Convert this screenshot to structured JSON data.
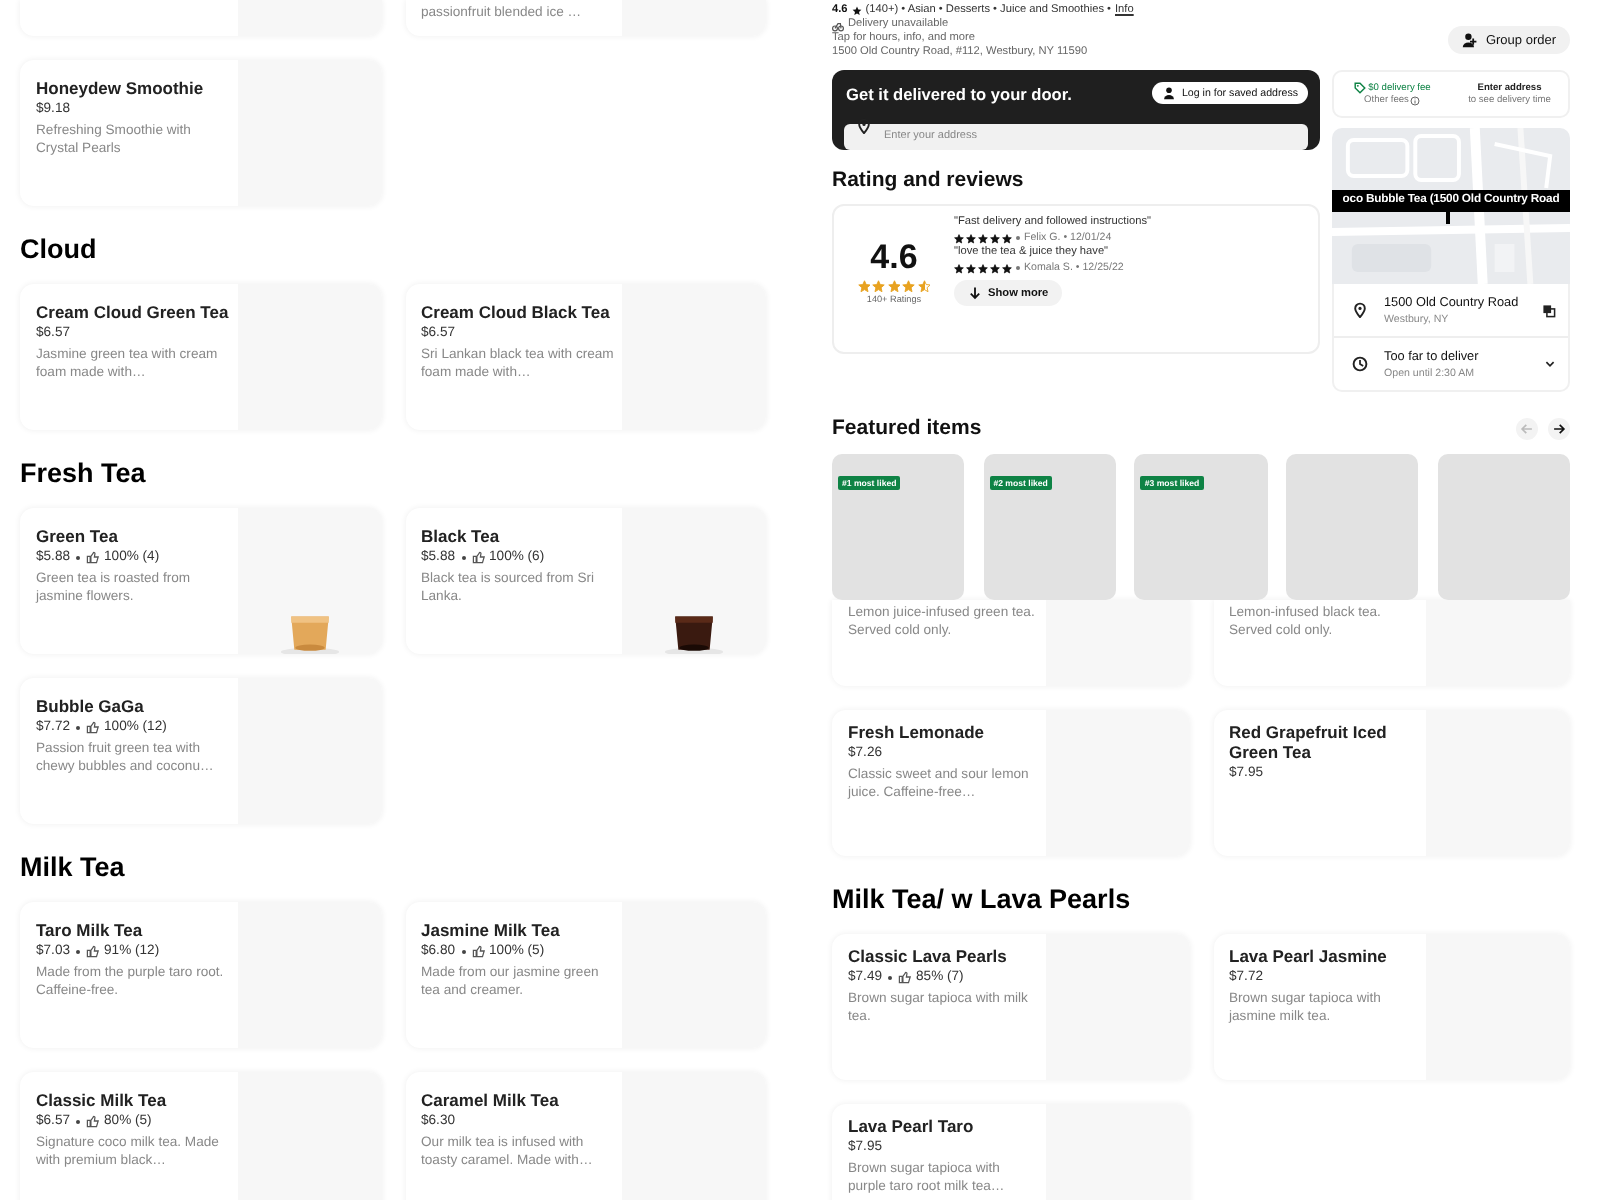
{
  "left_menu": {
    "sections": [
      {
        "items": [
          {
            "kind": "cut"
          },
          {
            "kind": "cut",
            "description": "passionfruit blended ice …"
          },
          {
            "kind": "plain",
            "name": "Honeydew Smoothie",
            "price": "$9.18",
            "description": "Refreshing Smoothie with Crystal Pearls"
          }
        ]
      },
      {
        "title": "Cloud",
        "items": [
          {
            "kind": "plain",
            "name": "Cream Cloud Green Tea",
            "price": "$6.57",
            "description": "Jasmine green tea with cream foam made with…"
          },
          {
            "kind": "plain",
            "name": "Cream Cloud Black Tea",
            "price": "$6.57",
            "description": "Sri Lankan black tea with cream foam made with…"
          }
        ]
      },
      {
        "title": "Fresh Tea",
        "items": [
          {
            "kind": "picture",
            "name": "Green Tea",
            "price": "$5.88",
            "rating": "100% (4)",
            "description": "Green tea is roasted from jasmine flowers."
          },
          {
            "kind": "picture",
            "name": "Black Tea",
            "price": "$5.88",
            "rating": "100% (6)",
            "description": "Black tea is sourced from Sri Lanka."
          },
          {
            "kind": "plain",
            "name": "Bubble GaGa",
            "price": "$7.72",
            "rating": "100% (12)",
            "description": "Passion fruit green tea with chewy bubbles and coconu…"
          }
        ]
      },
      {
        "title": "Milk Tea",
        "items": [
          {
            "kind": "plain",
            "name": "Taro Milk Tea",
            "price": "$7.03",
            "rating": "91% (12)",
            "description": "Made from the purple taro root. Caffeine-free."
          },
          {
            "kind": "plain",
            "name": "Jasmine Milk Tea",
            "price": "$6.80",
            "rating": "100% (5)",
            "description": "Made from our jasmine green tea and creamer."
          },
          {
            "kind": "plain",
            "name": "Classic Milk Tea",
            "price": "$6.57",
            "rating": "80% (5)",
            "description": "Signature coco milk tea. Made with premium black…"
          },
          {
            "kind": "plain",
            "name": "Caramel Milk Tea",
            "price": "$6.30",
            "description": "Our milk tea is infused with toasty caramel. Made with…"
          }
        ]
      }
    ]
  },
  "store_info": {
    "rating": "4.6",
    "tags": "(140+) • Asian • Desserts • Juice and Smoothies •",
    "info_link": "Info",
    "delivery_status": "Delivery unavailable",
    "hint": "Tap for hours, info, and more",
    "address": "1500 Old Country Road,  #112, Westbury, NY 11590",
    "group_order_button": "Group order"
  },
  "delivery_box": {
    "title": "Get it delivered to your door.",
    "login_button": "Log in for saved address",
    "address_field": {
      "placeholder": "Enter your address"
    }
  },
  "reviews": {
    "heading": "Rating and reviews",
    "score": "4.6",
    "stars": 4.5,
    "count": "140+ Ratings",
    "items": [
      {
        "quote": "\"Fast delivery and followed instructions\"",
        "stars": 5,
        "meta": "Felix G. • 12/01/24"
      },
      {
        "quote": "\"love the tea & juice they have\"",
        "stars": 5,
        "meta": "Komala S. • 12/25/22"
      }
    ],
    "show_more": "Show more"
  },
  "fees": {
    "fee": "$0 delivery fee",
    "other": "Other fees",
    "eta_title": "Enter address",
    "eta_hint": "to see delivery time"
  },
  "map": {
    "label": "oco Bubble Tea (1500 Old Country Road"
  },
  "location_rows": [
    {
      "kind": "address",
      "title": "1500 Old Country Road",
      "subtitle": "Westbury, NY"
    },
    {
      "kind": "hours",
      "title": "Too far to deliver",
      "subtitle": "Open until 2:30 AM"
    }
  ],
  "featured": {
    "heading": "Featured items",
    "prev_disabled": true,
    "next_disabled": false,
    "tiles": [
      {
        "kind": "ranked",
        "badge": "#1 most liked"
      },
      {
        "kind": "ranked",
        "badge": "#2 most liked"
      },
      {
        "kind": "ranked",
        "badge": "#3 most liked"
      },
      {
        "kind": "plain"
      },
      {
        "kind": "plain"
      }
    ]
  },
  "right_menu": {
    "sections": [
      {
        "items": [
          {
            "kind": "cut",
            "description": "Lemon juice-infused green tea. Served cold only."
          },
          {
            "kind": "cut",
            "description": "Lemon-infused black tea. Served cold only."
          },
          {
            "kind": "plain",
            "name": "Fresh Lemonade",
            "price": "$7.26",
            "description": "Classic sweet and sour lemon juice. Caffeine-free…"
          },
          {
            "kind": "plain",
            "name": "Red Grapefruit Iced Green Tea",
            "price": "$7.95"
          }
        ]
      },
      {
        "title": "Milk Tea/ w Lava Pearls",
        "items": [
          {
            "kind": "plain",
            "name": "Classic Lava Pearls",
            "price": "$7.49",
            "rating": "85% (7)",
            "description": "Brown sugar tapioca with milk tea."
          },
          {
            "kind": "plain",
            "name": "Lava Pearl Jasmine",
            "price": "$7.72",
            "description": "Brown sugar tapioca with jasmine milk tea."
          },
          {
            "kind": "plain",
            "name": "Lava Pearl Taro",
            "price": "$7.95",
            "description": "Brown sugar tapioca with purple taro root milk tea…"
          }
        ]
      }
    ]
  }
}
